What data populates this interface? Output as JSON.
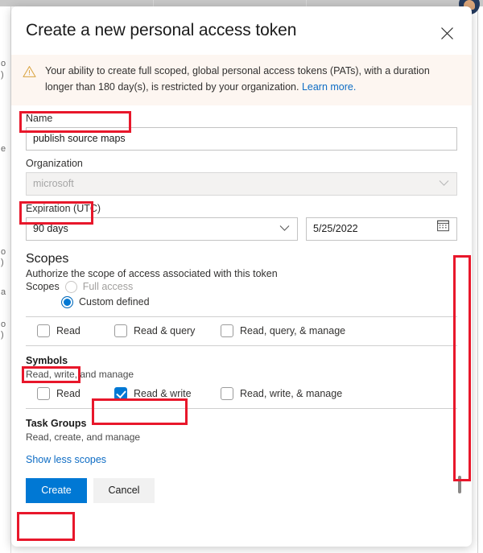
{
  "dialog": {
    "title": "Create a new personal access token",
    "close_icon": "close-icon"
  },
  "warning": {
    "icon": "warning-triangle-icon",
    "text": "Your ability to create full scoped, global personal access tokens (PATs), with a duration longer than 180 day(s), is restricted by your organization.",
    "link_text": "Learn more."
  },
  "fields": {
    "name": {
      "label": "Name",
      "value": "publish source maps",
      "placeholder": ""
    },
    "organization": {
      "label": "Organization",
      "value": "microsoft",
      "disabled": true,
      "chevron_icon": "chevron-down-icon"
    },
    "expiration": {
      "label": "Expiration (UTC)",
      "duration_value": "90 days",
      "chevron_icon": "chevron-down-icon",
      "date_value": "5/25/2022",
      "calendar_icon": "calendar-icon"
    }
  },
  "scopes": {
    "heading": "Scopes",
    "subheading": "Authorize the scope of access associated with this token",
    "radio_prefix": "Scopes",
    "options": [
      {
        "label": "Full access",
        "checked": false,
        "disabled": true
      },
      {
        "label": "Custom defined",
        "checked": true,
        "disabled": false
      }
    ],
    "groups": [
      {
        "name": "",
        "description": "",
        "checkboxes": [
          {
            "label": "Read",
            "checked": false
          },
          {
            "label": "Read & query",
            "checked": false
          },
          {
            "label": "Read, query, & manage",
            "checked": false
          }
        ]
      },
      {
        "name": "Symbols",
        "description": "Read, write, and manage",
        "checkboxes": [
          {
            "label": "Read",
            "checked": false
          },
          {
            "label": "Read & write",
            "checked": true
          },
          {
            "label": "Read, write, & manage",
            "checked": false
          }
        ]
      },
      {
        "name": "Task Groups",
        "description": "Read, create, and manage",
        "checkboxes": []
      }
    ]
  },
  "footer": {
    "show_less_link": "Show less scopes",
    "create_label": "Create",
    "cancel_label": "Cancel"
  },
  "colors": {
    "accent": "#0078d4",
    "link": "#0d6cc4",
    "annotation": "#e8172b",
    "warning_bg": "#fdf6f1",
    "warning_icon": "#d9a441"
  }
}
